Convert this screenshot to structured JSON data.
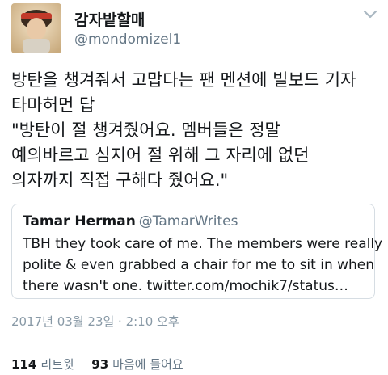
{
  "tweet": {
    "display_name": "감자밭할매",
    "handle": "@mondomizel1",
    "body_lines": [
      "방탄을 챙겨줘서 고맙다는 팬 멘션에 빌보드 기자",
      "타마허먼 답",
      "\"방탄이 절 챙겨줬어요. 멤버들은 정말",
      "예의바르고 심지어 절 위해 그 자리에 없던",
      "의자까지 직접 구해다 줬어요.\""
    ],
    "quoted": {
      "name": "Tamar Herman",
      "handle": "@TamarWrites",
      "lines": [
        "TBH they took care of me. The members were really",
        "polite & even grabbed a chair for me to sit in when",
        "there wasn't one. twitter.com/mochik7/status…"
      ]
    },
    "timestamp": "2017년 03월 23일 · 2:10 오후",
    "stats": {
      "retweets_count": "114",
      "retweets_label": "리트윗",
      "likes_count": "93",
      "likes_label": "마음에 들어요"
    },
    "avatar_icon": "profile-photo",
    "menu_icon": "chevron-down-icon"
  }
}
